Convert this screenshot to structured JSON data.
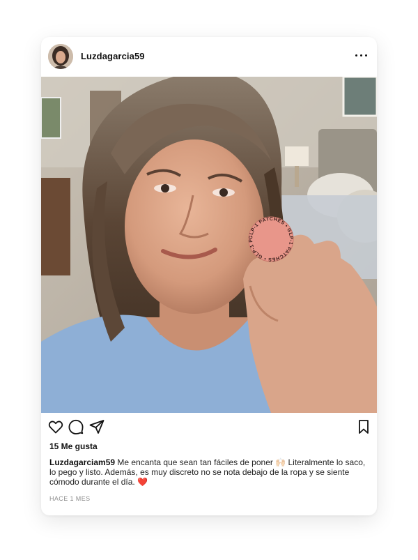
{
  "post": {
    "username": "Luzdagarcia59",
    "likes_label": "15 Me gusta",
    "caption_username": "Luzdagarciam59",
    "caption_text": " Me encanta que sean tan fáciles de poner 🙌🏻 Literalmente lo saco, lo pego y listo. Además, es muy discreto no se nota debajo de la ropa y se siente cómodo durante el día. ❤️",
    "time_label": "HACE 1 MES",
    "patch_text": "GLP-1 PATCHES • GLP-1 PATCHES • GLP-1 PATCHES •"
  },
  "icons": {
    "like": "heart-icon",
    "comment": "comment-icon",
    "share": "send-icon",
    "save": "bookmark-icon",
    "more": "more-icon"
  },
  "colors": {
    "patch": "#e8968a",
    "shirt": "#8eafd6",
    "text": "#111111",
    "muted": "#8e8e8e"
  }
}
